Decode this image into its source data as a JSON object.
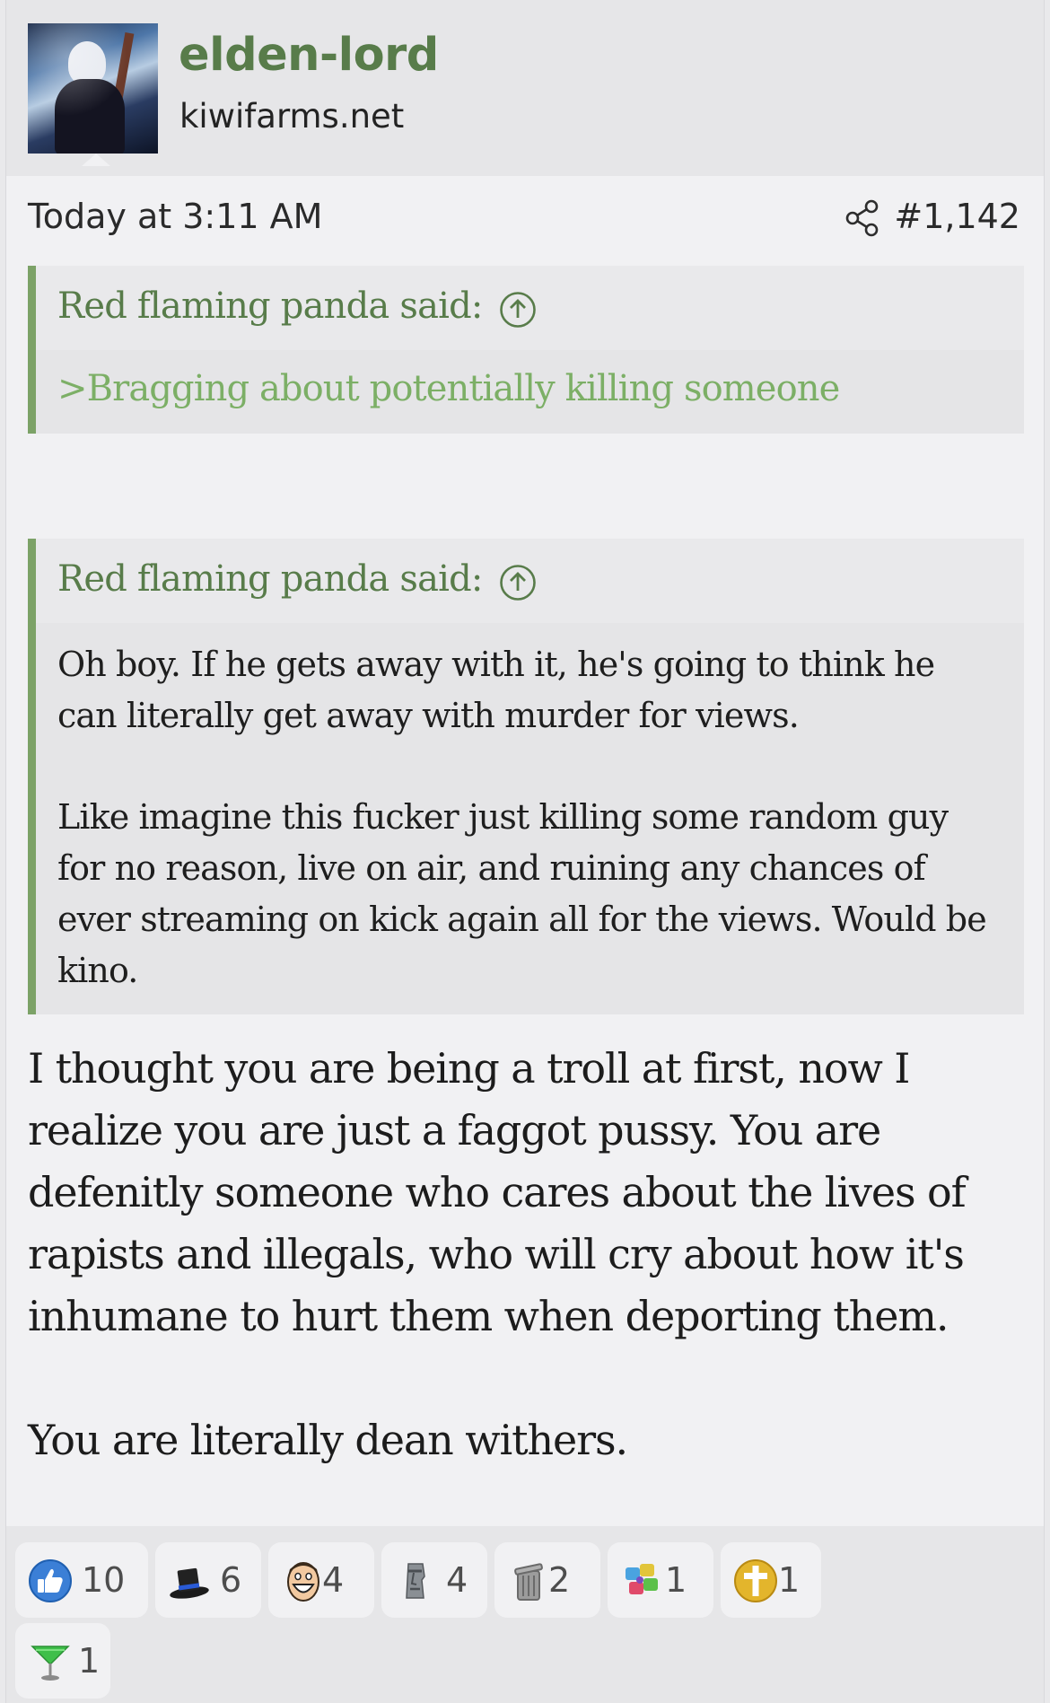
{
  "author": {
    "username": "elden-lord",
    "site": "kiwifarms.net"
  },
  "meta": {
    "date": "Today at 3:11 AM",
    "post_number": "#1,142",
    "share_icon": "share-icon"
  },
  "quotes": [
    {
      "author_label": "Red flaming panda said:",
      "body": [
        ">Bragging about potentially killing someone"
      ],
      "style": "greentext"
    },
    {
      "author_label": "Red flaming panda said:",
      "body": [
        "Oh boy. If he gets away with it, he's going to think he can literally get away with murder for views.",
        "Like imagine this fucker just killing some random guy for no reason, live on air, and ruining any chances of ever streaming on kick again all for the views. Would be kino."
      ]
    }
  ],
  "message": [
    "I thought you are being a troll at first, now I realize you are just a faggot pussy. You are defenitly someone who cares about the lives of rapists and illegals, who will cry about how it's inhumane to hurt them when deporting them.",
    "You are literally dean withers."
  ],
  "reactions": [
    {
      "icon": "thumbs-up-icon",
      "count": "10"
    },
    {
      "icon": "top-hat-icon",
      "count": "6"
    },
    {
      "icon": "laughing-face-icon",
      "count": "4"
    },
    {
      "icon": "moai-icon",
      "count": "4"
    },
    {
      "icon": "trash-can-icon",
      "count": "2"
    },
    {
      "icon": "autism-puzzle-icon",
      "count": "1"
    },
    {
      "icon": "cross-icon",
      "count": "1"
    },
    {
      "icon": "cocktail-glass-icon",
      "count": "1"
    }
  ],
  "colors": {
    "accent_green": "#587c4a",
    "quote_bar": "#7ca267",
    "greentext": "#7caf66",
    "post_bg": "#f1f1f3",
    "header_bg": "#e6e6e8"
  }
}
